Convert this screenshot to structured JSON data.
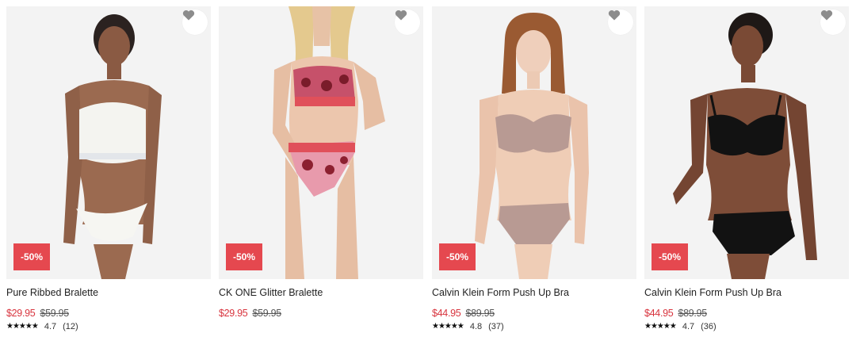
{
  "colors": {
    "badge": "#e5484f",
    "sale_price": "#d8343e",
    "background": "#ffffff",
    "image_bg": "#f2f2f2"
  },
  "products": [
    {
      "name": "Pure Ribbed Bralette",
      "discount": "-50%",
      "price": "$29.95",
      "old_price": "$59.95",
      "stars": "★★★★★",
      "rating": "4.7",
      "reviews": "(12)",
      "wishlist_icon": "heart-icon"
    },
    {
      "name": "CK ONE Glitter Bralette",
      "discount": "-50%",
      "price": "$29.95",
      "old_price": "$59.95",
      "wishlist_icon": "heart-icon"
    },
    {
      "name": "Calvin Klein Form Push Up Bra",
      "discount": "-50%",
      "price": "$44.95",
      "old_price": "$89.95",
      "stars": "★★★★★",
      "rating": "4.8",
      "reviews": "(37)",
      "wishlist_icon": "heart-icon"
    },
    {
      "name": "Calvin Klein Form Push Up Bra",
      "discount": "-50%",
      "price": "$44.95",
      "old_price": "$89.95",
      "stars": "★★★★★",
      "rating": "4.7",
      "reviews": "(36)",
      "wishlist_icon": "heart-icon"
    }
  ]
}
